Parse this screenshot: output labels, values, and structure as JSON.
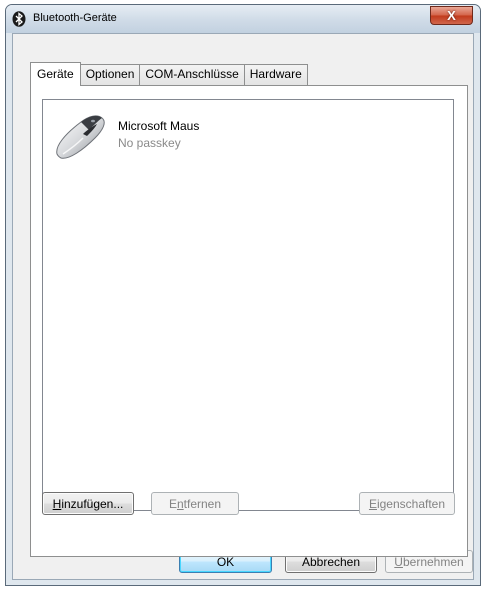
{
  "window": {
    "title": "Bluetooth-Geräte",
    "close_label": "X"
  },
  "tabs": [
    {
      "label": "Geräte",
      "active": true
    },
    {
      "label": "Optionen",
      "active": false
    },
    {
      "label": "COM-Anschlüsse",
      "active": false
    },
    {
      "label": "Hardware",
      "active": false
    }
  ],
  "devices": [
    {
      "name": "Microsoft Maus",
      "status": "No passkey",
      "icon": "mouse-icon"
    }
  ],
  "panel_buttons": {
    "add": {
      "label": "Hinzufügen...",
      "mnemonic": "H",
      "rest": "inzufügen...",
      "enabled": true
    },
    "remove": {
      "label": "Entfernen",
      "pre": "E",
      "mnemonic": "n",
      "rest": "tfernen",
      "enabled": false
    },
    "properties": {
      "label": "Eigenschaften",
      "mnemonic": "E",
      "rest": "igenschaften",
      "enabled": false
    }
  },
  "dialog_buttons": {
    "ok": {
      "label": "OK",
      "enabled": true
    },
    "cancel": {
      "label": "Abbrechen",
      "enabled": true
    },
    "apply": {
      "label": "Übernehmen",
      "mnemonic": "Ü",
      "rest": "bernehmen",
      "enabled": false
    }
  },
  "colors": {
    "frame": "#dfe7ee",
    "close_button": "#c23a1c",
    "bluetooth": "#1a1a1a",
    "disabled_text": "#838383"
  }
}
